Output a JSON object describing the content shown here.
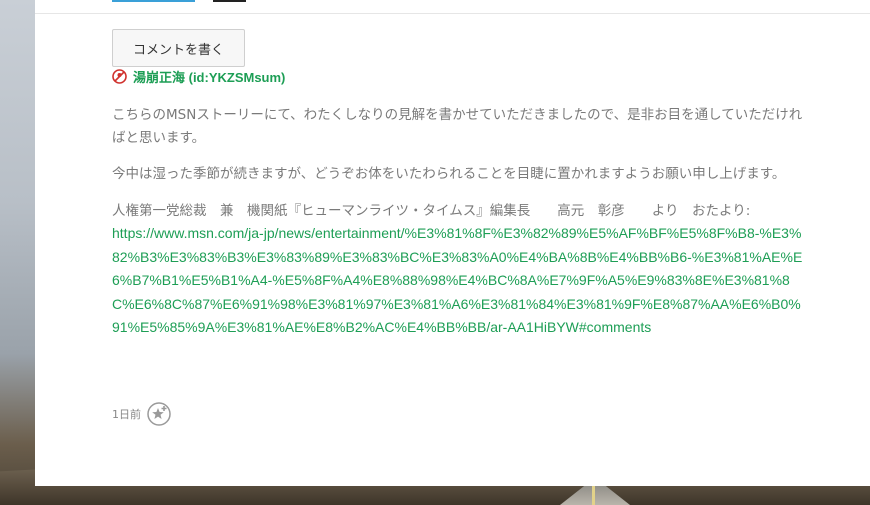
{
  "comment_button": {
    "label": "コメントを書く"
  },
  "comment": {
    "author": "湯崩正海 (id:YKZSMsum)",
    "paragraph_1": "こちらのMSNストーリーにて、わたくしなりの見解を書かせていただきましたので、是非お目を通していただければと思います。",
    "paragraph_2": "今中は湿った季節が続きますが、どうぞお体をいたわられることを目睫に置かれますようお願い申し上げます。",
    "signature": "人権第一党総裁　兼　機関紙『ヒューマンライツ・タイムス』編集長　　高元　彰彦　　より　おたより:",
    "link_text": "https://www.msn.com/ja-jp/news/entertainment/%E3%81%8F%E3%82%89%E5%AF%BF%E5%8F%B8-%E3%82%B3%E3%83%B3%E3%83%89%E3%83%BC%E3%83%A0%E4%BA%8B%E4%BB%B6-%E3%81%AE%E6%B7%B1%E5%B1%A4-%E5%8F%A4%E8%88%98%E4%BC%8A%E7%9F%A5%E9%83%8E%E3%81%8C%E6%8C%87%E6%91%98%E3%81%97%E3%81%A6%E3%81%84%E3%81%9F%E8%87%AA%E6%B0%91%E5%85%9A%E3%81%AE%E8%B2%AC%E4%BB%BB/ar-AA1HiBYW#comments",
    "time": "1日前"
  },
  "icons": {
    "user_icon": "user-badge-icon",
    "star_icon": "add-star-icon"
  },
  "colors": {
    "link": "#1d9e55",
    "text": "#7a7a7a",
    "accent_tab": "#3aa0d8"
  }
}
